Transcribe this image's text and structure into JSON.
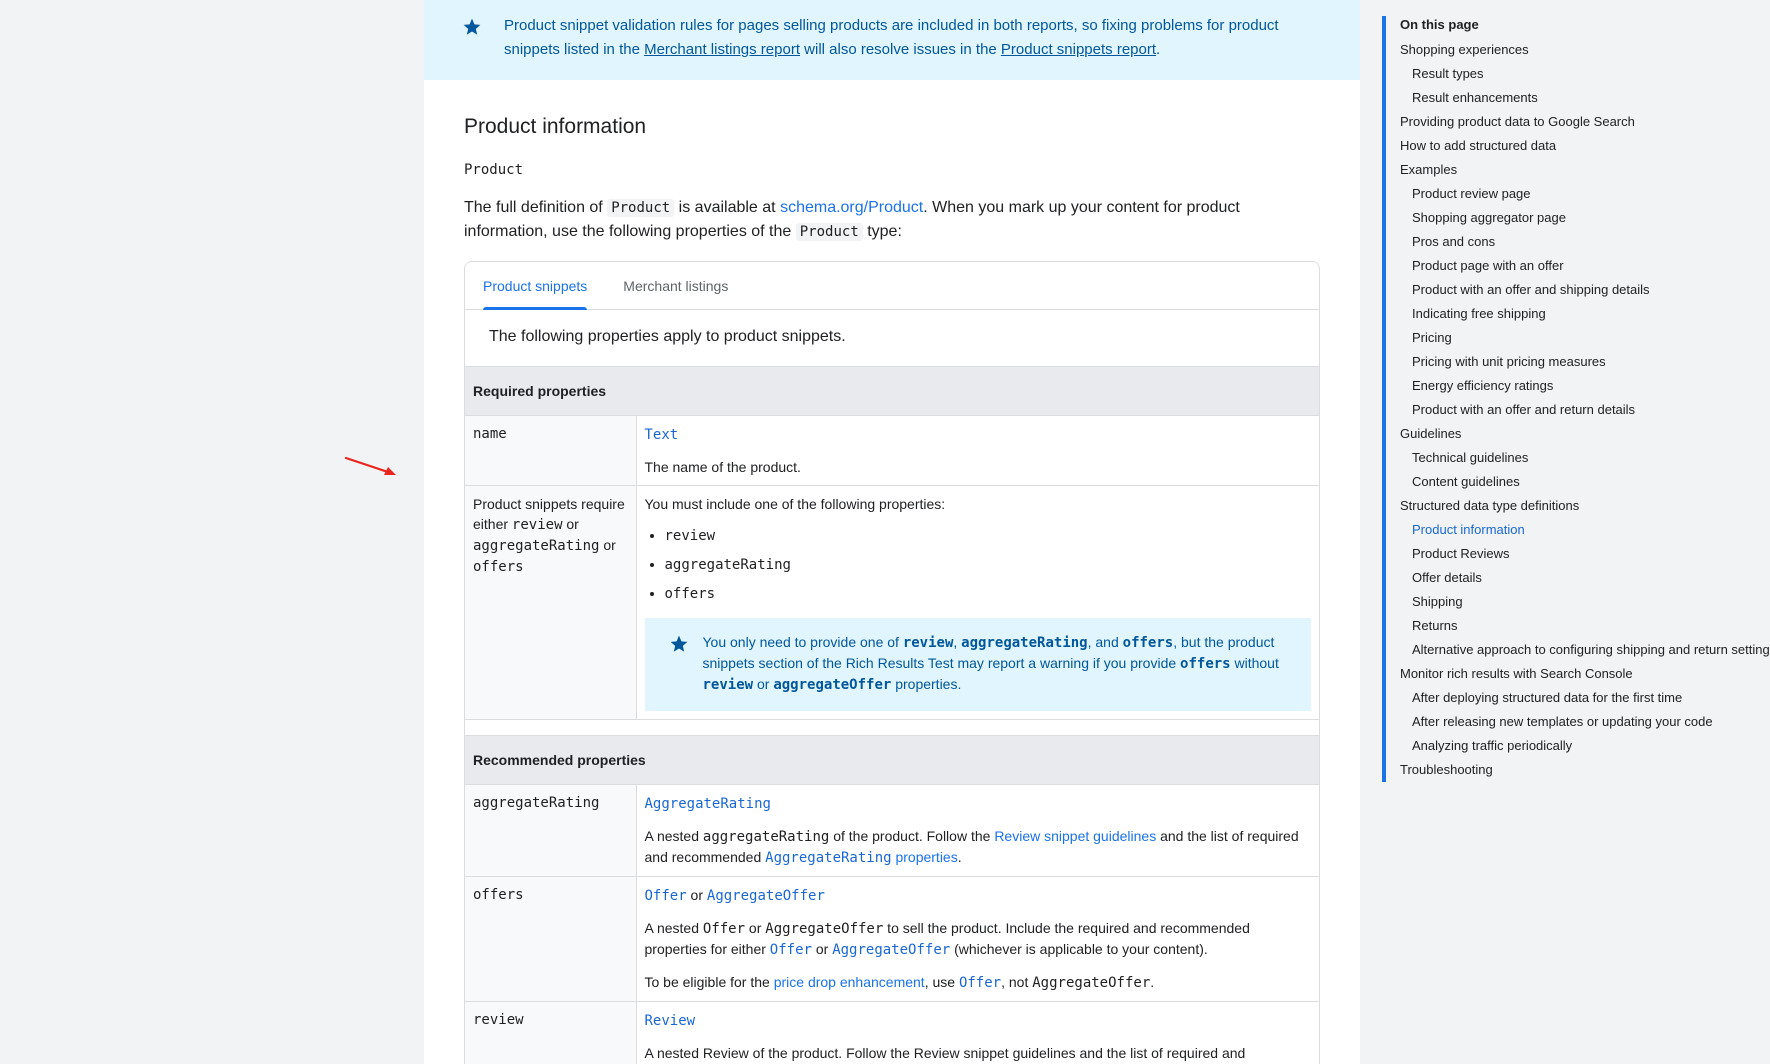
{
  "top_note": {
    "text_a": "Product snippet validation rules for pages selling products are included in both reports, so fixing problems for product snippets listed in the ",
    "link1": "Merchant listings report",
    "text_b": " will also resolve issues in the ",
    "link2": "Product snippets report",
    "text_c": "."
  },
  "section": {
    "heading": "Product information",
    "type_name": "Product",
    "intro": {
      "t1": "The full definition of ",
      "code1": "Product",
      "t2": " is available at ",
      "link": "schema.org/Product",
      "t3": ". When you mark up your content for product information, use the following properties of the ",
      "code2": "Product",
      "t4": " type:"
    }
  },
  "tabs": {
    "items": [
      {
        "label": "Product snippets"
      },
      {
        "label": "Merchant listings"
      }
    ],
    "intro": "The following properties apply to product snippets."
  },
  "required": {
    "heading": "Required properties",
    "name_row": {
      "prop": "name",
      "type": "Text",
      "desc": "The name of the product."
    },
    "either_row": {
      "label_t1": "Product snippets require either ",
      "label_c1": "review",
      "label_t2": " or ",
      "label_c2": "aggregateRating",
      "label_t3": " or ",
      "label_c3": "offers",
      "lead": "You must include one of the following properties:",
      "options": [
        "review",
        "aggregateRating",
        "offers"
      ],
      "note": {
        "t1": "You only need to provide one of ",
        "c1": "review",
        "t2": ", ",
        "c2": "aggregateRating",
        "t3": ", and ",
        "c3": "offers",
        "t4": ", but the product snippets section of the Rich Results Test may report a warning if you provide ",
        "c4": "offers",
        "t5": " without ",
        "c5": "review",
        "t6": " or ",
        "c6": "aggregateOffer",
        "t7": " properties."
      }
    }
  },
  "recommended": {
    "heading": "Recommended properties",
    "aggregate_row": {
      "prop": "aggregateRating",
      "type": "AggregateRating",
      "t1": "A nested ",
      "c1": "aggregateRating",
      "t2": " of the product. Follow the ",
      "link1": "Review snippet guidelines",
      "t3": " and the list of required and recommended ",
      "link2_code": "AggregateRating",
      "link2_text": " properties",
      "t4": "."
    },
    "offers_row": {
      "prop": "offers",
      "type1": "Offer",
      "or": " or ",
      "type2": "AggregateOffer",
      "p1_t1": "A nested ",
      "p1_c1": "Offer",
      "p1_t2": " or ",
      "p1_c2": "AggregateOffer",
      "p1_t3": " to sell the product. Include the required and recommended properties for either ",
      "p1_l1": "Offer",
      "p1_t4": " or ",
      "p1_l2": "AggregateOffer",
      "p1_t5": " (whichever is applicable to your content).",
      "p2_t1": "To be eligible for the ",
      "p2_link": "price drop enhancement",
      "p2_t2": ", use ",
      "p2_l1": "Offer",
      "p2_t3": ", not ",
      "p2_c1": "AggregateOffer",
      "p2_t4": "."
    },
    "review_row": {
      "prop": "review",
      "type": "Review",
      "desc": "A nested Review of the product. Follow the Review snippet guidelines and the list of required and"
    }
  },
  "toc": {
    "title": "On this page",
    "items": [
      {
        "label": "Shopping experiences",
        "level": 1
      },
      {
        "label": "Result types",
        "level": 2
      },
      {
        "label": "Result enhancements",
        "level": 2
      },
      {
        "label": "Providing product data to Google Search",
        "level": 1
      },
      {
        "label": "How to add structured data",
        "level": 1
      },
      {
        "label": "Examples",
        "level": 1
      },
      {
        "label": "Product review page",
        "level": 2
      },
      {
        "label": "Shopping aggregator page",
        "level": 2
      },
      {
        "label": "Pros and cons",
        "level": 2
      },
      {
        "label": "Product page with an offer",
        "level": 2
      },
      {
        "label": "Product with an offer and shipping details",
        "level": 2
      },
      {
        "label": "Indicating free shipping",
        "level": 2
      },
      {
        "label": "Pricing",
        "level": 2
      },
      {
        "label": "Pricing with unit pricing measures",
        "level": 2
      },
      {
        "label": "Energy efficiency ratings",
        "level": 2
      },
      {
        "label": "Product with an offer and return details",
        "level": 2
      },
      {
        "label": "Guidelines",
        "level": 1
      },
      {
        "label": "Technical guidelines",
        "level": 2
      },
      {
        "label": "Content guidelines",
        "level": 2
      },
      {
        "label": "Structured data type definitions",
        "level": 1
      },
      {
        "label": "Product information",
        "level": 2,
        "current": true
      },
      {
        "label": "Product Reviews",
        "level": 2
      },
      {
        "label": "Offer details",
        "level": 2
      },
      {
        "label": "Shipping",
        "level": 2
      },
      {
        "label": "Returns",
        "level": 2
      },
      {
        "label": "Alternative approach to configuring shipping and return settings",
        "level": 2
      },
      {
        "label": "Monitor rich results with Search Console",
        "level": 1
      },
      {
        "label": "After deploying structured data for the first time",
        "level": 2
      },
      {
        "label": "After releasing new templates or updating your code",
        "level": 2
      },
      {
        "label": "Analyzing traffic periodically",
        "level": 2
      },
      {
        "label": "Troubleshooting",
        "level": 1
      }
    ]
  },
  "colors": {
    "accent": "#1a73e8",
    "note_bg": "#e1f5fe",
    "note_text": "#01579b",
    "arrow": "#e8251f"
  }
}
